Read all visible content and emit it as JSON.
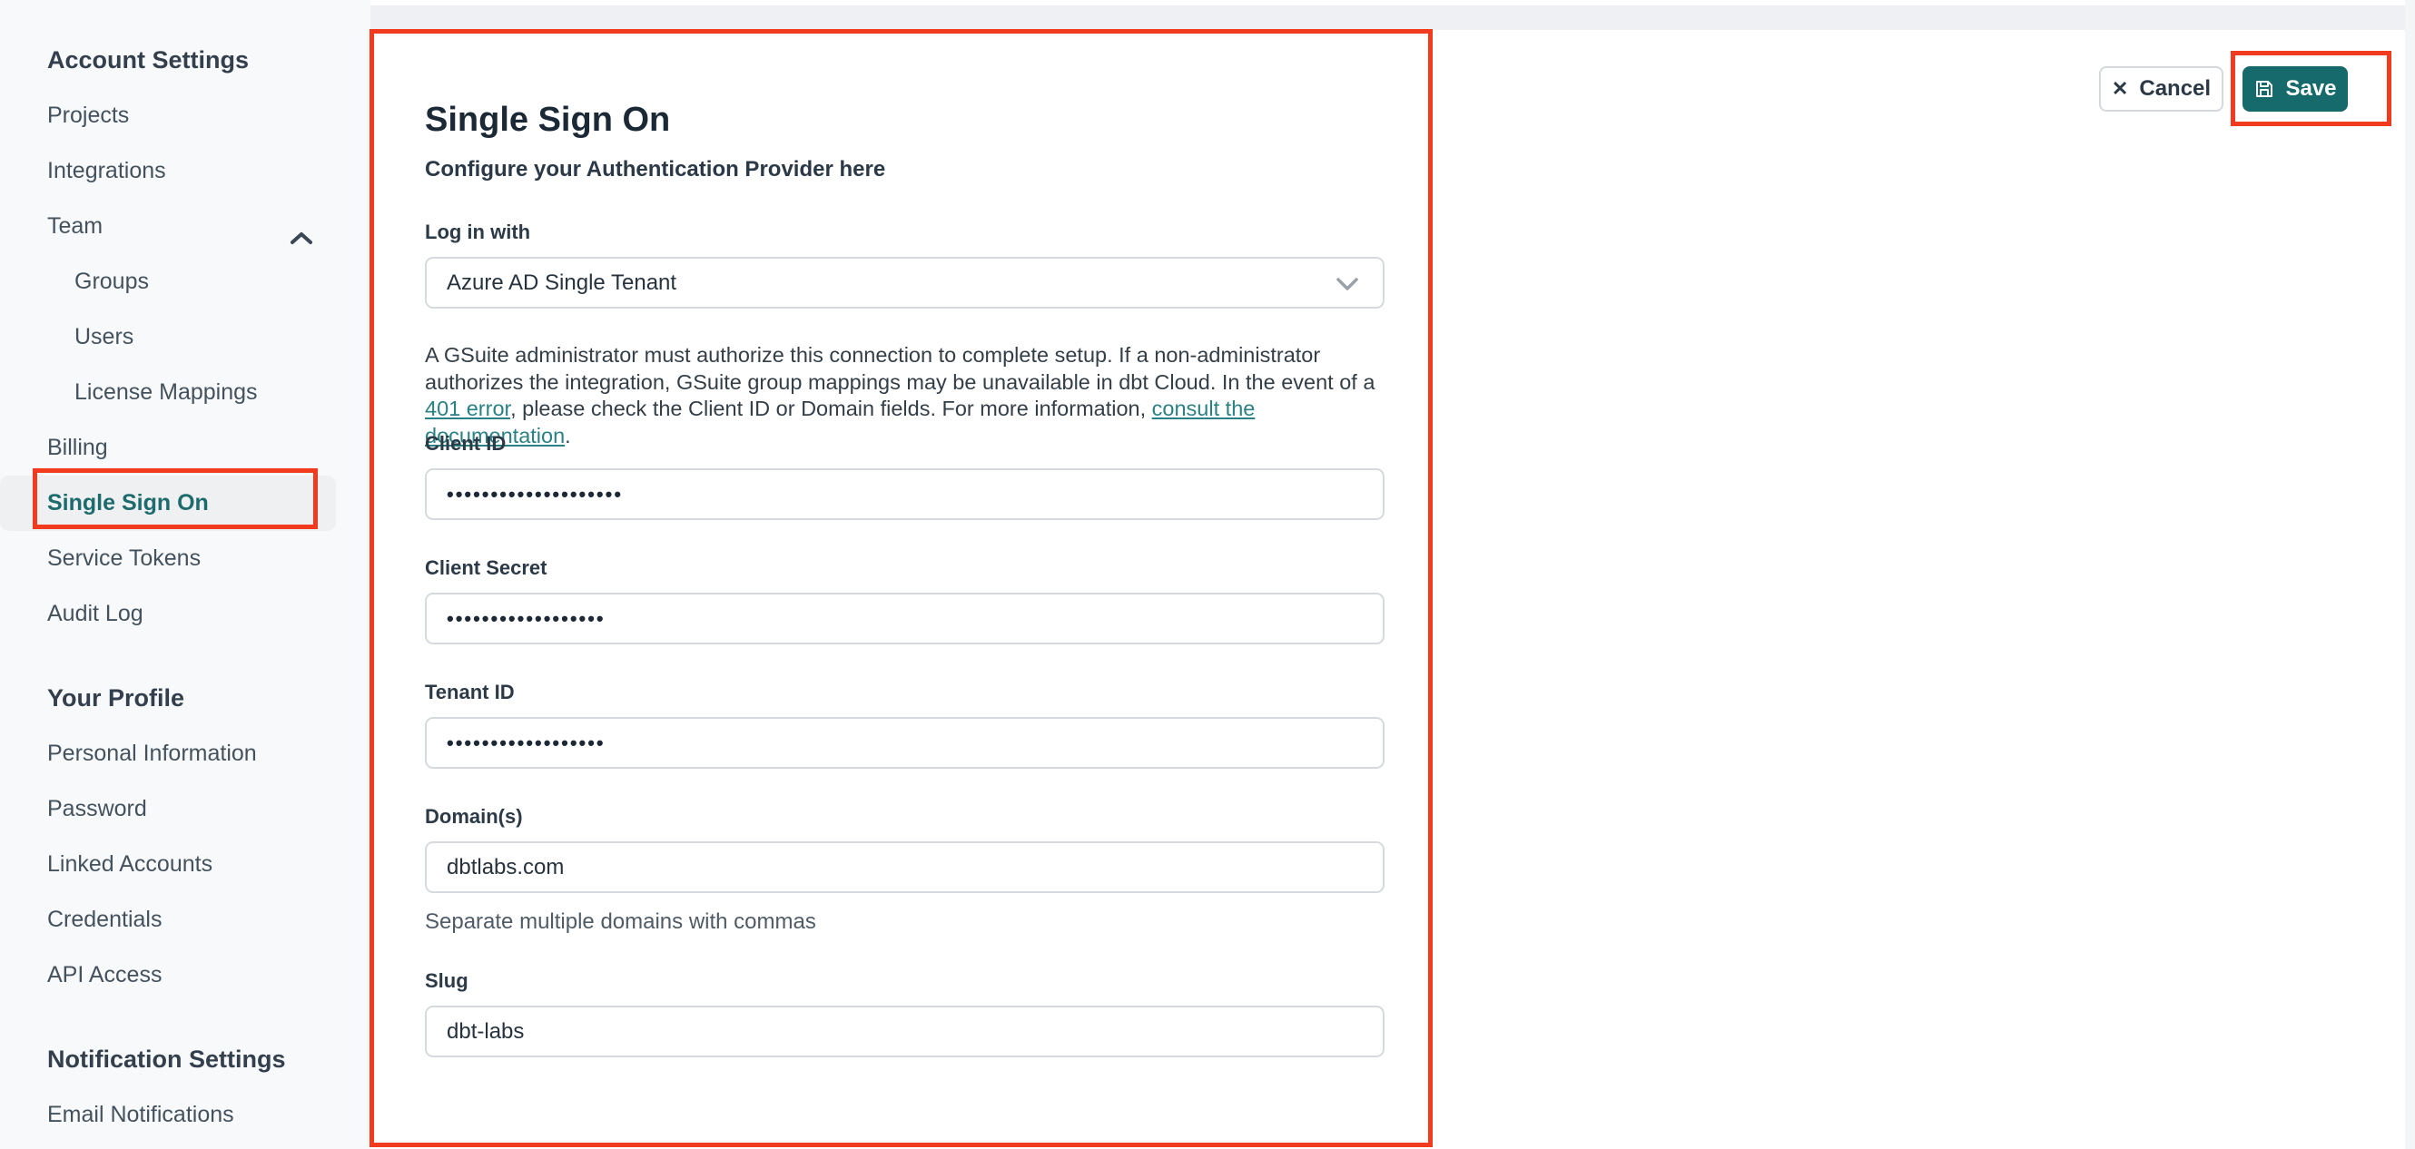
{
  "sidebar": {
    "account": {
      "heading": "Account Settings",
      "items": [
        "Projects",
        "Integrations",
        "Team",
        "Groups",
        "Users",
        "License Mappings",
        "Billing",
        "Single Sign On",
        "Service Tokens",
        "Audit Log"
      ]
    },
    "profile": {
      "heading": "Your Profile",
      "items": [
        "Personal Information",
        "Password",
        "Linked Accounts",
        "Credentials",
        "API Access"
      ]
    },
    "notifications": {
      "heading": "Notification Settings",
      "items": [
        "Email Notifications"
      ]
    }
  },
  "main": {
    "title": "Single Sign On",
    "subtitle": "Configure your Authentication Provider here",
    "login_with": {
      "label": "Log in with",
      "value": "Azure AD Single Tenant"
    },
    "notice": {
      "seg1": "A GSuite administrator must authorize this connection to complete setup. If a non-administrator authorizes the integration, GSuite group mappings may be unavailable in dbt Cloud. In the event of a ",
      "link1": "401 error",
      "seg2": ", please check the Client ID or Domain fields. For more information, ",
      "link2": "consult the documentation",
      "seg3": "."
    },
    "fields": {
      "client_id": {
        "label": "Client ID",
        "value": "••••••••••••••••••••"
      },
      "client_secret": {
        "label": "Client Secret",
        "value": "••••••••••••••••••"
      },
      "tenant_id": {
        "label": "Tenant ID",
        "value": "••••••••••••••••••"
      },
      "domains": {
        "label": "Domain(s)",
        "value": "dbtlabs.com",
        "helper": "Separate multiple domains with commas"
      },
      "slug": {
        "label": "Slug",
        "value": "dbt-labs"
      }
    }
  },
  "actions": {
    "cancel": "Cancel",
    "save": "Save"
  },
  "colors": {
    "accent_teal": "#176a6c",
    "link_teal": "#2a8184",
    "annotation_red": "#f23b1e"
  }
}
